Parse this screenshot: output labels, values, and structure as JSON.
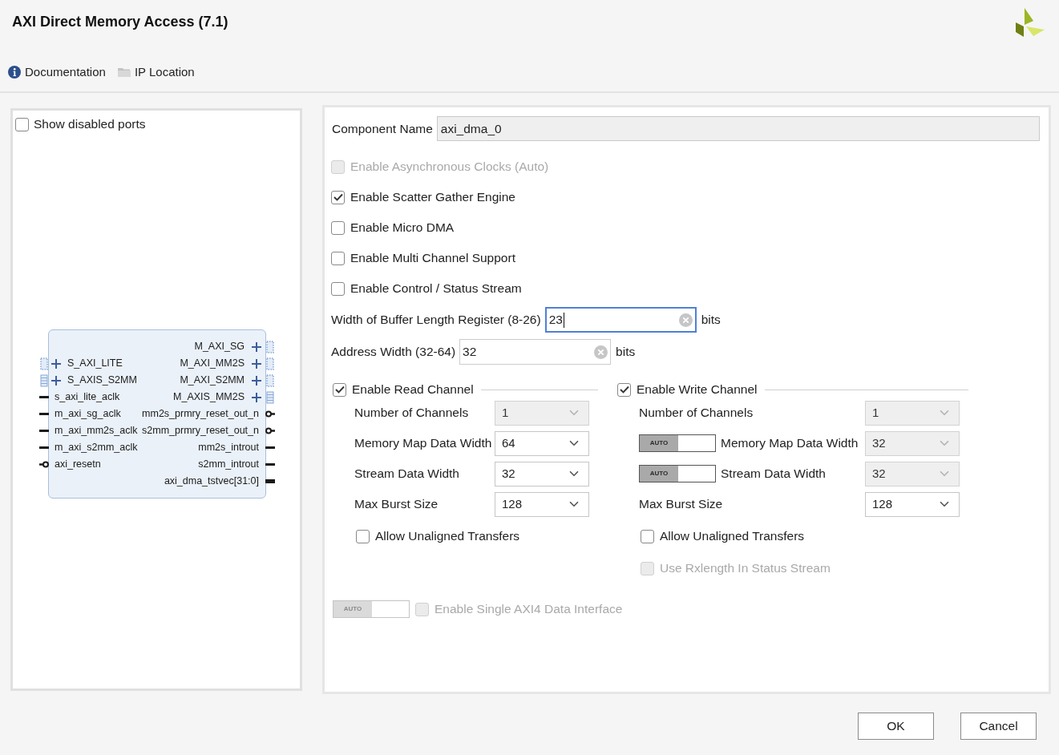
{
  "window": {
    "title": "AXI Direct Memory Access (7.1)"
  },
  "toolbar": [
    {
      "kind": "info",
      "label": "Documentation"
    },
    {
      "kind": "folder",
      "label": "IP Location"
    }
  ],
  "symbol_panel": {
    "show_disabled_ports": {
      "label": "Show disabled ports",
      "checked": false
    },
    "block": {
      "left_ports": [
        {
          "kind": "bus",
          "name": "S_AXI_LITE"
        },
        {
          "kind": "stream",
          "name": "S_AXIS_S2MM"
        },
        {
          "kind": "wire",
          "name": "s_axi_lite_aclk"
        },
        {
          "kind": "wire",
          "name": "m_axi_sg_aclk"
        },
        {
          "kind": "wire",
          "name": "m_axi_mm2s_aclk"
        },
        {
          "kind": "wire",
          "name": "m_axi_s2mm_aclk"
        },
        {
          "kind": "inverted",
          "name": "axi_resetn"
        }
      ],
      "right_ports": [
        {
          "kind": "bus",
          "name": "M_AXI_SG"
        },
        {
          "kind": "bus",
          "name": "M_AXI_MM2S"
        },
        {
          "kind": "bus",
          "name": "M_AXI_S2MM"
        },
        {
          "kind": "stream",
          "name": "M_AXIS_MM2S"
        },
        {
          "kind": "inverted",
          "name": "mm2s_prmry_reset_out_n"
        },
        {
          "kind": "inverted",
          "name": "s2mm_prmry_reset_out_n"
        },
        {
          "kind": "wire",
          "name": "mm2s_introut"
        },
        {
          "kind": "wire",
          "name": "s2mm_introut"
        },
        {
          "kind": "vector",
          "name": "axi_dma_tstvec[31:0]"
        }
      ]
    }
  },
  "config_panel": {
    "component_name": {
      "label": "Component Name",
      "value": "axi_dma_0"
    },
    "options": [
      {
        "label": "Enable Asynchronous Clocks (Auto)",
        "checked": false,
        "disabled": true
      },
      {
        "label": "Enable Scatter Gather Engine",
        "checked": true,
        "disabled": false
      },
      {
        "label": "Enable Micro DMA",
        "checked": false,
        "disabled": false
      },
      {
        "label": "Enable Multi Channel Support",
        "checked": false,
        "disabled": false
      },
      {
        "label": "Enable Control / Status Stream",
        "checked": false,
        "disabled": false
      }
    ],
    "fields": [
      {
        "label": "Width of Buffer Length Register (8-26)",
        "value": "23",
        "unit": "bits",
        "focused": true
      },
      {
        "label": "Address Width (32-64)",
        "value": "32",
        "unit": "bits",
        "focused": false
      }
    ],
    "channels": [
      {
        "label": "Enable Read Channel",
        "checked": true,
        "params": [
          {
            "kind": "select",
            "label": "Number of Channels",
            "value": "1",
            "disabled": true
          },
          {
            "kind": "select",
            "label": "Memory Map Data Width",
            "value": "64",
            "disabled": false
          },
          {
            "kind": "select",
            "label": "Stream Data Width",
            "value": "32",
            "disabled": false
          },
          {
            "kind": "select",
            "label": "Max Burst Size",
            "value": "128",
            "disabled": false
          }
        ],
        "options": [
          {
            "label": "Allow Unaligned Transfers",
            "checked": false,
            "disabled": false
          }
        ]
      },
      {
        "label": "Enable Write Channel",
        "checked": true,
        "params": [
          {
            "kind": "select",
            "label": "Number of Channels",
            "value": "1",
            "disabled": true
          },
          {
            "kind": "auto_select",
            "auto_label": "AUTO",
            "label": "Memory Map Data Width",
            "value": "32",
            "disabled": true
          },
          {
            "kind": "auto_select",
            "auto_label": "AUTO",
            "label": "Stream Data Width",
            "value": "32",
            "disabled": true
          },
          {
            "kind": "select",
            "label": "Max Burst Size",
            "value": "128",
            "disabled": false
          }
        ],
        "options": [
          {
            "label": "Allow Unaligned Transfers",
            "checked": false,
            "disabled": false
          },
          {
            "label": "Use Rxlength In Status Stream",
            "checked": false,
            "disabled": true
          }
        ]
      }
    ],
    "single_interface": {
      "auto_label": "AUTO",
      "label": "Enable Single AXI4 Data Interface",
      "checked": false,
      "disabled": true
    }
  },
  "buttons": [
    {
      "label": "OK"
    },
    {
      "label": "Cancel"
    }
  ]
}
